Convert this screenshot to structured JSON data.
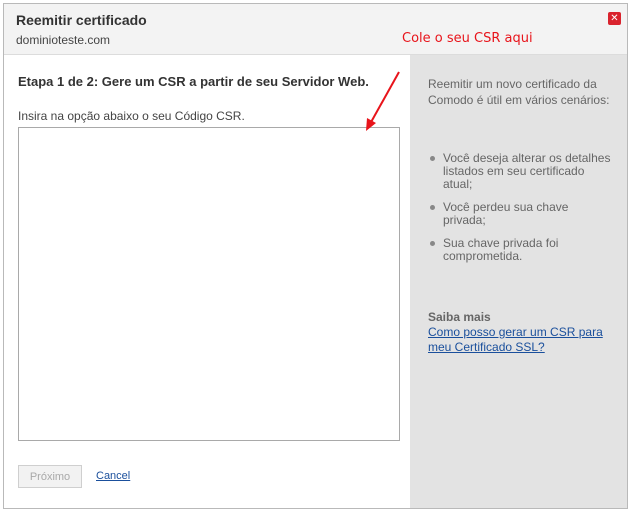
{
  "dialog": {
    "title": "Reemitir certificado",
    "domain": "dominioteste.com",
    "close_icon": "close-icon",
    "close_glyph": "✕"
  },
  "annotation": {
    "text": "Cole o seu CSR aqui",
    "color": "#e8141b"
  },
  "main": {
    "step_heading": "Etapa 1 de 2: Gere um CSR a partir de seu Servidor Web.",
    "instruction": "Insira na opção abaixo o seu Código CSR.",
    "csr_value": "",
    "next_label": "Próximo",
    "cancel_label": "Cancel"
  },
  "sidebar": {
    "intro": "Reemitir um novo certificado da Comodo é útil em vários cenários:",
    "bullets": [
      "Você deseja alterar os detalhes listados em seu certificado atual;",
      "Você perdeu sua chave privada;",
      "Sua chave privada foi comprometida."
    ],
    "learn_more_heading": "Saiba mais",
    "learn_more_link": "Como posso gerar um CSR para meu Certificado SSL?"
  },
  "colors": {
    "close_button": "#d9232d",
    "link": "#1a4f9c",
    "sidebar_bg": "#e3e3e3"
  }
}
